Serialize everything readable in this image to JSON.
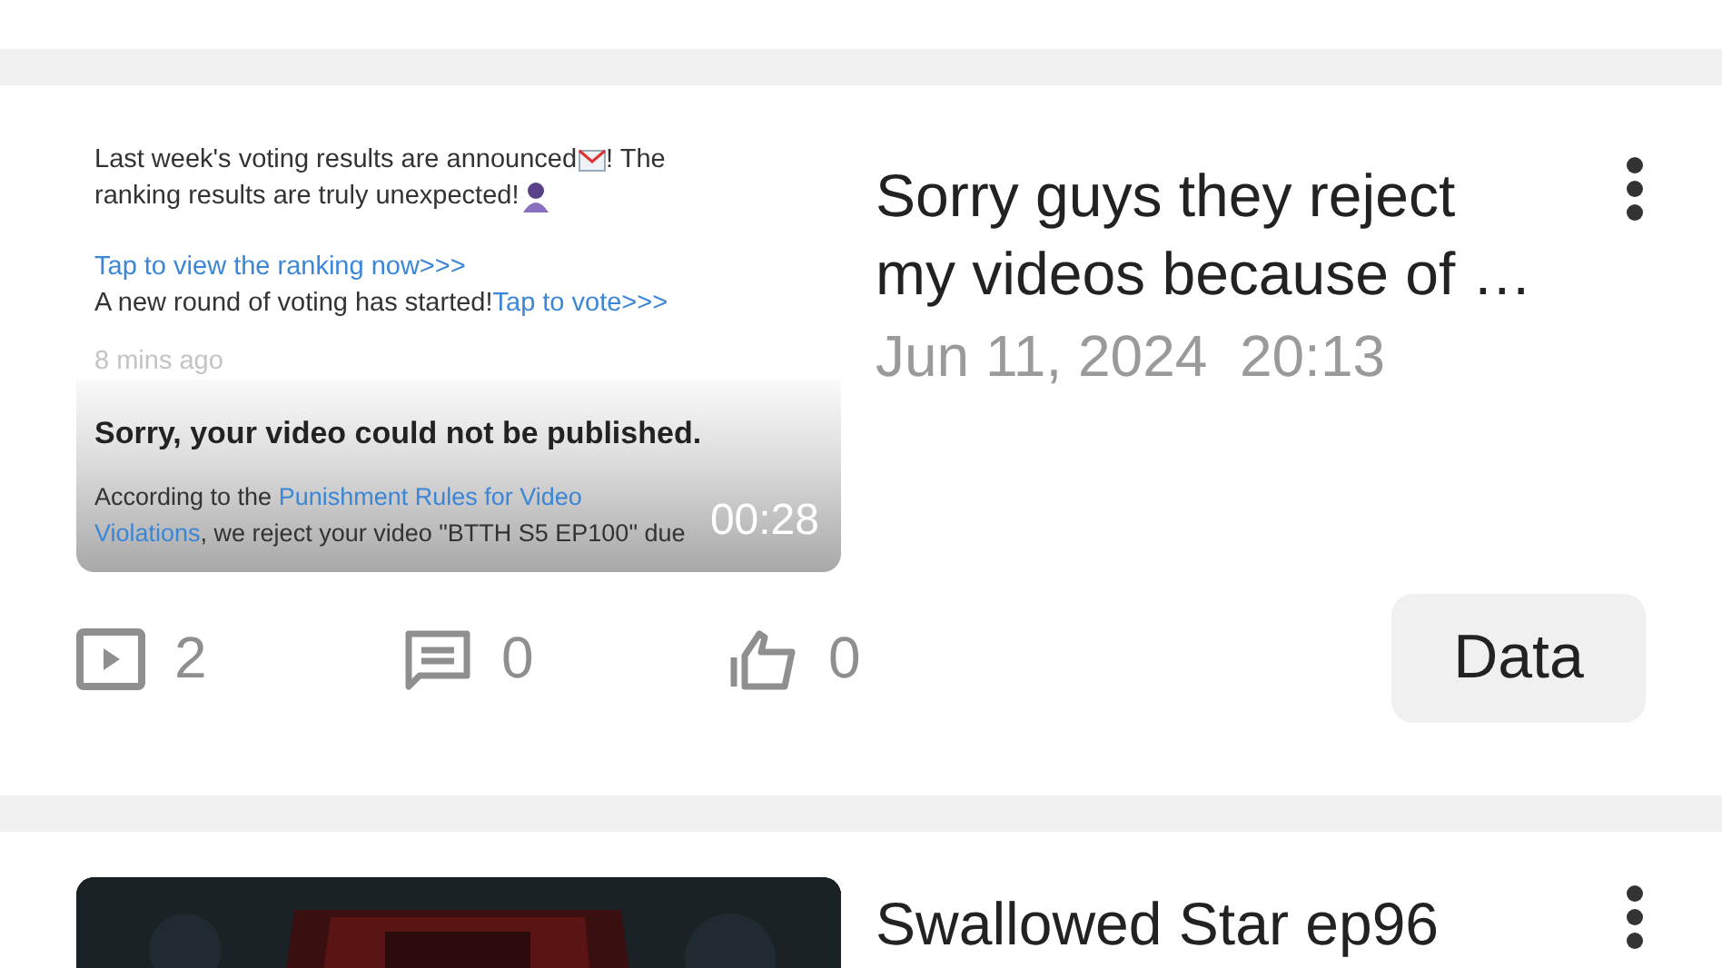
{
  "cards": [
    {
      "thumbnail": {
        "kind": "screenshot",
        "paragraphs": [
          [
            [
              {
                "kind": "text",
                "text": "Last week's voting results are announced"
              },
              {
                "kind": "emoji"
              },
              {
                "kind": "text",
                "text": "! The"
              }
            ],
            [
              {
                "kind": "text",
                "text": "ranking results are truly unexpected!"
              },
              {
                "kind": "emoji"
              }
            ]
          ],
          [
            [
              {
                "kind": "link",
                "text": "Tap to view the ranking now>>>"
              }
            ],
            [
              {
                "kind": "text",
                "text": "A new round of voting has started!"
              },
              {
                "kind": "link",
                "text": "Tap to vote>>>"
              }
            ]
          ]
        ],
        "time": "8 mins ago",
        "notice_title": "Sorry, your video could not be published.",
        "notice_lines": [
          [
            {
              "kind": "text",
              "text": "According to the "
            },
            {
              "kind": "link",
              "text": "Punishment Rules for Video"
            }
          ],
          [
            {
              "kind": "link",
              "text": "Violations"
            },
            {
              "kind": "text",
              "text": ", we reject your video \"BTTH S5 EP100\" due"
            }
          ]
        ],
        "duration": "00:28"
      },
      "title": "Sorry guys they reject my videos because of …",
      "date": "Jun 11, 2024  20:13",
      "stats": [
        {
          "kind": "plays",
          "count": "2"
        },
        {
          "kind": "comments",
          "count": "0"
        },
        {
          "kind": "likes",
          "count": "0"
        }
      ],
      "button": "Data"
    },
    {
      "title": "Swallowed Star ep96"
    }
  ]
}
